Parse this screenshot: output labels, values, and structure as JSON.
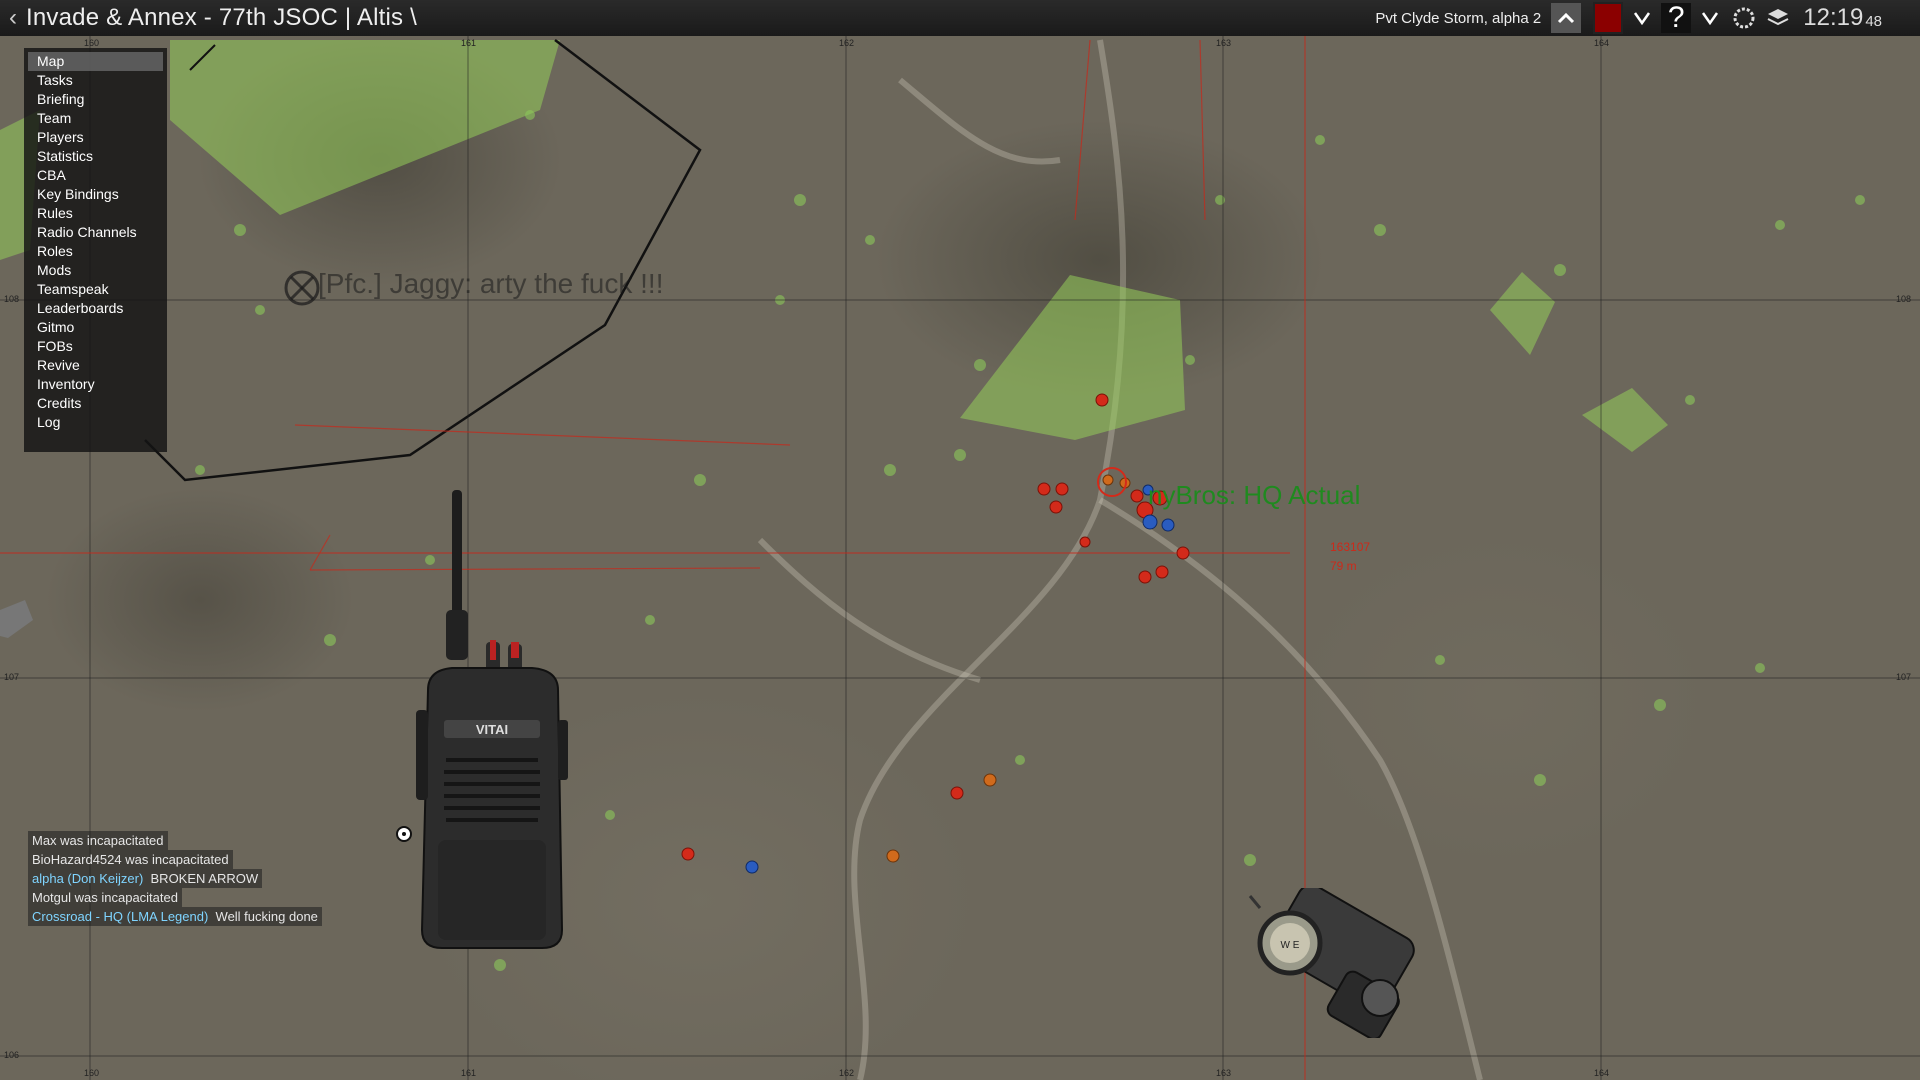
{
  "window": {
    "title": "Invade & Annex - 77th JSOC | Altis \\",
    "player": "Pvt Clyde Storm, alpha 2",
    "time": "12:19",
    "seconds": "48"
  },
  "side_menu": {
    "items": [
      "Map",
      "Tasks",
      "Briefing",
      "Team",
      "Players",
      "Statistics",
      "CBA",
      "Key Bindings",
      "Rules",
      "Radio Channels",
      "Roles",
      "Mods",
      "Teamspeak",
      "Leaderboards",
      "Gitmo",
      "FOBs",
      "Revive",
      "Inventory",
      "Credits",
      "Log"
    ],
    "active": "Map"
  },
  "map": {
    "marker_text": "[Pfc.] Jaggy: arty the fuck !!!",
    "hq_label": "nyBros: HQ Actual",
    "grid_ref": "163107",
    "distance": "79 m",
    "grid_x_labels": [
      "160",
      "161",
      "162",
      "163",
      "164"
    ],
    "grid_y_labels": [
      "108",
      "107",
      "106"
    ]
  },
  "chat": [
    {
      "channel": "",
      "text": "Max was incapacitated"
    },
    {
      "channel": "",
      "text": "BioHazard4524 was incapacitated"
    },
    {
      "channel": "alpha (Don Keijzer)",
      "text": "BROKEN ARROW"
    },
    {
      "channel": "",
      "text": "Motgul was incapacitated"
    },
    {
      "channel": "Crossroad - HQ (LMA Legend)",
      "text": "Well fucking done"
    }
  ],
  "icons": {
    "back": "chevron-left-icon",
    "collapse": "chevron-up-icon",
    "help": "question-icon",
    "settings": "gear-icon",
    "layers": "layers-icon"
  },
  "colors": {
    "team_color": "#8b0000",
    "enemy": "#d42a1a",
    "friendly": "#2a5cc0",
    "hq_text": "#1f8a1f",
    "grid_red": "#c0281a"
  },
  "radio_brand": "VITAI",
  "compass_letters": "W E"
}
